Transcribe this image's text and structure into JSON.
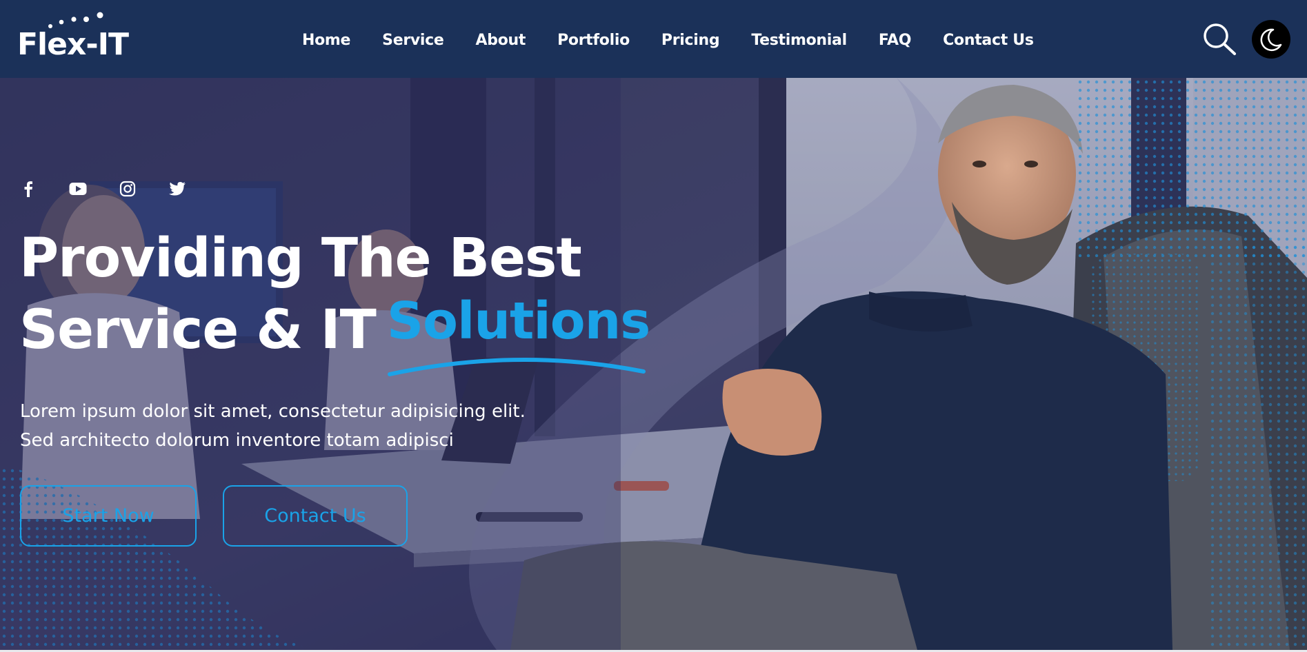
{
  "brand": {
    "name": "Flex-IT"
  },
  "nav": {
    "items": [
      {
        "label": "Home"
      },
      {
        "label": "Service"
      },
      {
        "label": "About"
      },
      {
        "label": "Portfolio"
      },
      {
        "label": "Pricing"
      },
      {
        "label": "Testimonial"
      },
      {
        "label": "FAQ"
      },
      {
        "label": "Contact Us"
      }
    ]
  },
  "header_icons": {
    "search": "search-icon",
    "theme": "moon-icon"
  },
  "hero": {
    "socials": [
      "facebook-icon",
      "youtube-icon",
      "instagram-icon",
      "twitter-icon"
    ],
    "title_line1": "Providing The Best",
    "title_line2": "Service & IT",
    "title_accent": "Solutions",
    "subtitle_line1": "Lorem ipsum dolor sit amet, consectetur adipisicing elit.",
    "subtitle_line2": "Sed architecto dolorum inventore totam adipisci",
    "primary_button": "Start Now",
    "secondary_button": "Contact Us"
  },
  "colors": {
    "header_bg": "#1b3159",
    "accent": "#1aa3e8",
    "hero_overlay": "#2c2f63",
    "text": "#ffffff"
  }
}
